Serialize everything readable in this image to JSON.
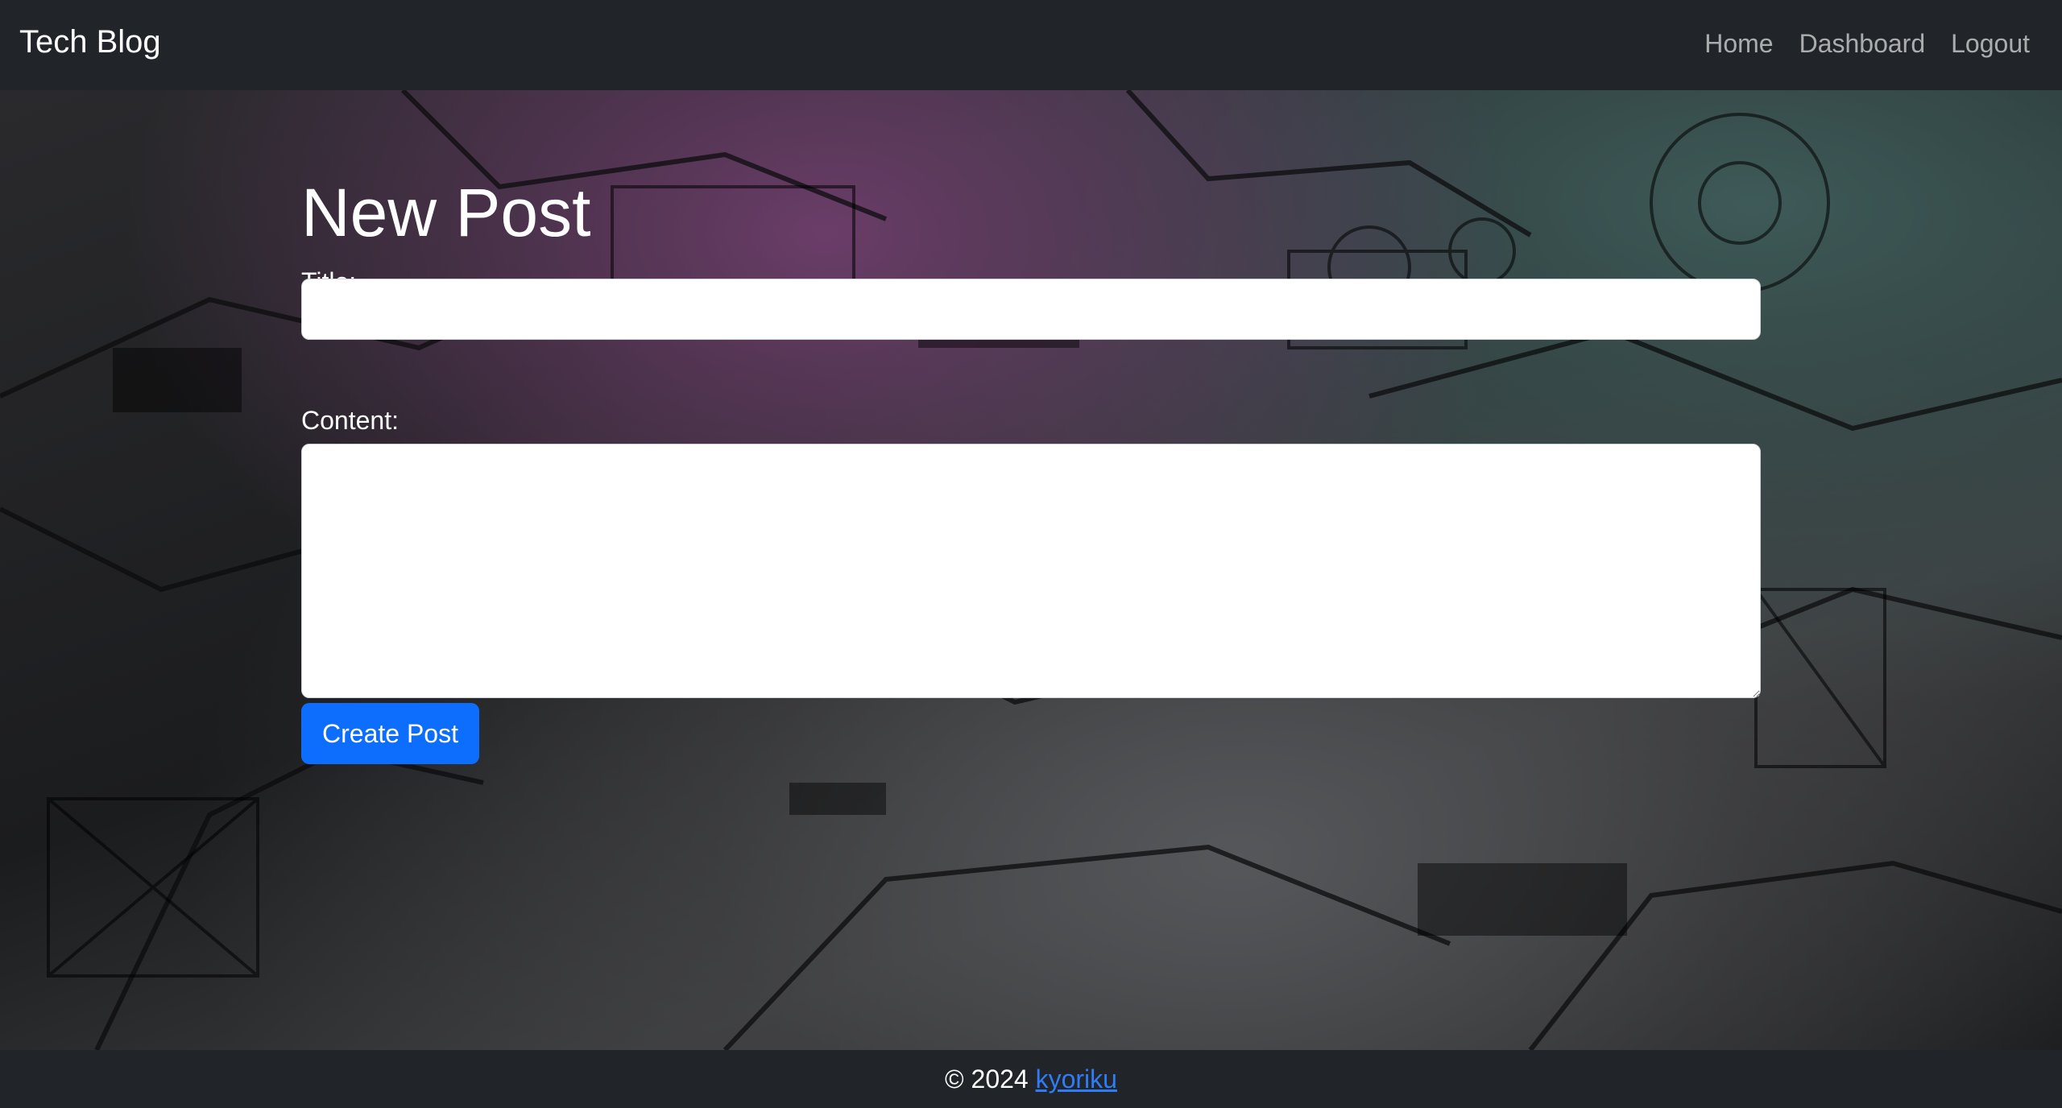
{
  "navbar": {
    "brand": "Tech Blog",
    "links": [
      {
        "label": "Home"
      },
      {
        "label": "Dashboard"
      },
      {
        "label": "Logout"
      }
    ]
  },
  "form": {
    "heading": "New Post",
    "title_label": "Title:",
    "title_value": "",
    "content_label": "Content:",
    "content_value": "",
    "submit_label": "Create Post"
  },
  "footer": {
    "copyright": "© 2024",
    "author_link": "kyoriku"
  },
  "colors": {
    "navbar_bg": "#212529",
    "primary": "#0d6efd",
    "link": "#2f7df6"
  }
}
